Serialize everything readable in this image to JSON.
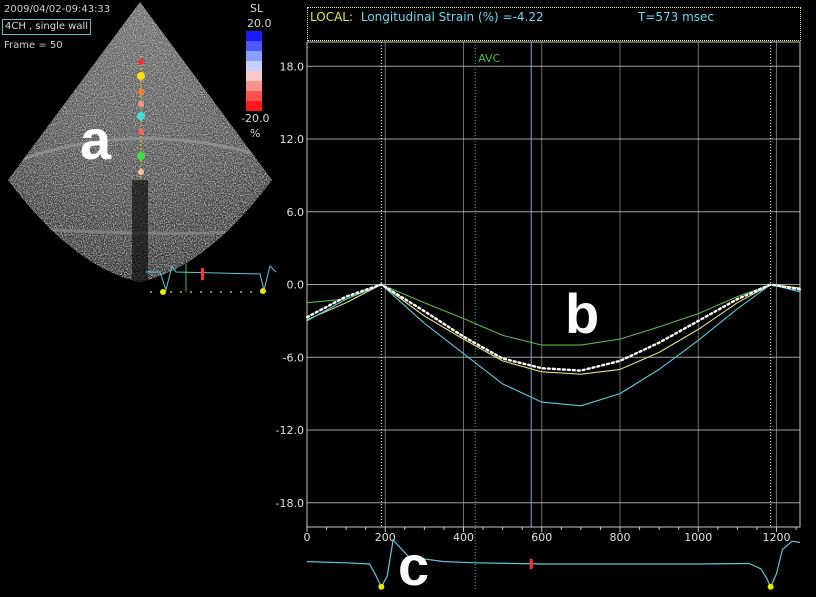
{
  "header": {
    "timestamp": "2009/04/02-09:43:33",
    "view_label": "4CH , single wall",
    "frame_label": "Frame = 50"
  },
  "colorbar": {
    "title": "SL",
    "max_label": "20.0",
    "min_label": "-20.0",
    "unit": "%"
  },
  "panel_labels": {
    "a": "a",
    "b": "b",
    "c": "c"
  },
  "local_box": {
    "prefix": "LOCAL:",
    "text": "Longitudinal Strain (%) =-4.22",
    "time": "T=573 msec"
  },
  "colors": {
    "background": "#000000",
    "grid": "#c8c8c8",
    "local_label": "#e8e860",
    "readout": "#70d8e8",
    "avc": "#40c040",
    "cyan_trace": "#5ec8d8",
    "green_trace": "#58b848",
    "yellow_trace": "#e0e080",
    "average_trace": "#ffffff",
    "colorbar": [
      "#1a1aff",
      "#4a5aff",
      "#8aa0ff",
      "#c8d0ff",
      "#ffc8c8",
      "#ff9090",
      "#ff5050",
      "#ff1818"
    ]
  },
  "chart_data": {
    "type": "line",
    "ylim": [
      -20,
      20
    ],
    "xlim": [
      0,
      1260
    ],
    "y_ticks": [
      "18.0",
      "12.0",
      "6.0",
      "0.0",
      "-6.0",
      "-12.0",
      "-18.0"
    ],
    "y_tick_values": [
      18,
      12,
      6,
      0,
      -6,
      -12,
      -18
    ],
    "x_ticks": [
      "0",
      "200",
      "400",
      "600",
      "800",
      "1000",
      "1200"
    ],
    "x_tick_values": [
      0,
      200,
      400,
      600,
      800,
      1000,
      1200
    ],
    "annotations": [
      {
        "label": "AVC",
        "x": 430
      }
    ],
    "markers": [
      {
        "x": 190,
        "style": "dotted"
      },
      {
        "x": 573,
        "style": "solid"
      },
      {
        "x": 1185,
        "style": "dotted"
      }
    ],
    "series": [
      {
        "style": "dotted-white",
        "x": [
          0,
          100,
          190,
          300,
          400,
          500,
          600,
          700,
          800,
          900,
          1000,
          1100,
          1185,
          1260
        ],
        "y": [
          -2.7,
          -1.0,
          0.0,
          -2.2,
          -4.3,
          -6.1,
          -6.9,
          -7.1,
          -6.3,
          -4.8,
          -3.0,
          -1.2,
          0.0,
          -0.4
        ]
      },
      {
        "style": "green",
        "x": [
          0,
          100,
          190,
          300,
          400,
          500,
          600,
          700,
          800,
          900,
          1000,
          1100,
          1185,
          1260
        ],
        "y": [
          -1.5,
          -1.2,
          0.0,
          -1.5,
          -2.8,
          -4.2,
          -5.0,
          -5.0,
          -4.5,
          -3.5,
          -2.4,
          -1.0,
          0.0,
          -0.3
        ]
      },
      {
        "style": "yellow",
        "x": [
          0,
          100,
          190,
          300,
          400,
          500,
          600,
          700,
          800,
          900,
          1000,
          1100,
          1185,
          1260
        ],
        "y": [
          -2.9,
          -1.5,
          0.0,
          -2.6,
          -4.5,
          -6.3,
          -7.2,
          -7.4,
          -7.0,
          -5.6,
          -3.7,
          -1.5,
          0.0,
          -0.3
        ]
      },
      {
        "style": "cyan",
        "x": [
          0,
          100,
          190,
          300,
          400,
          500,
          600,
          700,
          800,
          900,
          1000,
          1100,
          1185,
          1260
        ],
        "y": [
          -3.0,
          -1.2,
          0.0,
          -3.2,
          -5.7,
          -8.2,
          -9.7,
          -10.0,
          -9.0,
          -7.0,
          -4.6,
          -2.0,
          0.0,
          -0.6
        ]
      }
    ],
    "ecg": {
      "x": [
        0,
        100,
        160,
        175,
        190,
        205,
        220,
        260,
        350,
        430,
        600,
        800,
        1000,
        1130,
        1160,
        1175,
        1185,
        1200,
        1215,
        1240,
        1260
      ],
      "y": [
        0.1,
        0.05,
        0.0,
        -0.45,
        -0.95,
        -0.5,
        1.0,
        0.3,
        0.1,
        0.05,
        0.0,
        0.0,
        0.0,
        0.02,
        -0.2,
        -0.6,
        -0.95,
        -0.4,
        0.6,
        0.95,
        0.9
      ],
      "r_peaks": [
        190,
        1185
      ],
      "current_time": 573
    }
  }
}
